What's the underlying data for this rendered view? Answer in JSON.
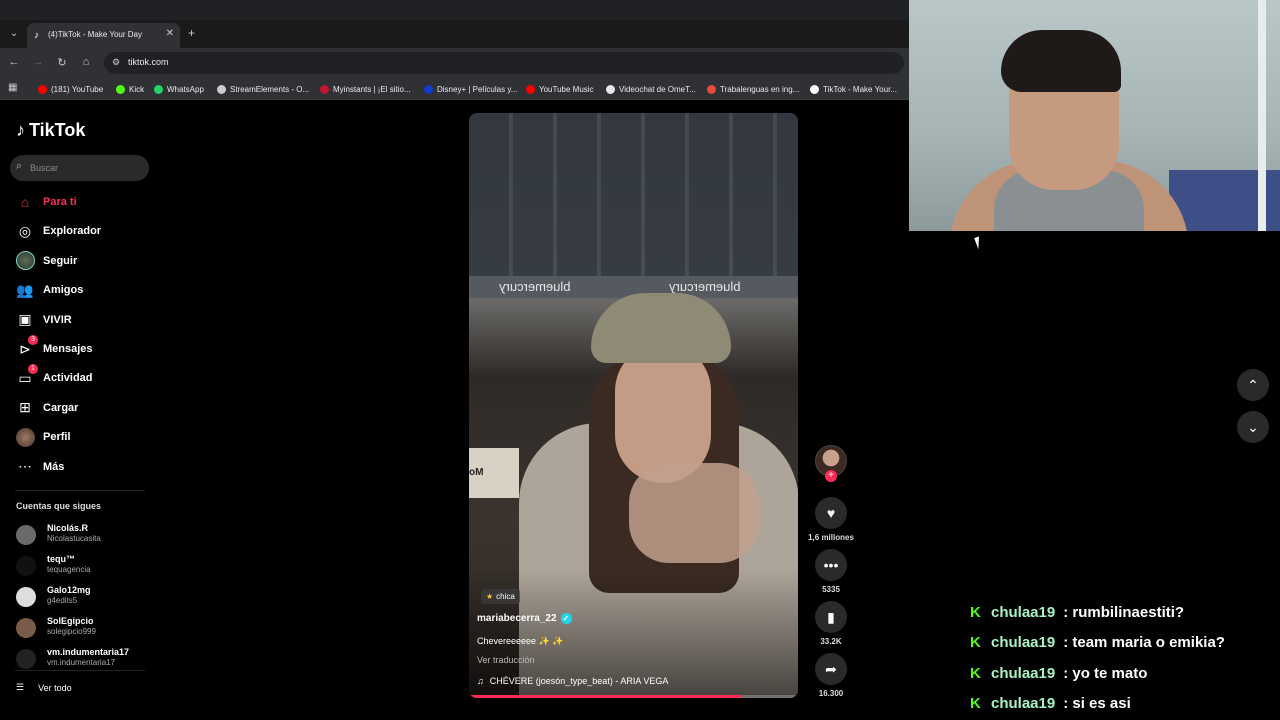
{
  "browser": {
    "tab_title": "(4)TikTok - Make Your Day",
    "url": "tiktok.com",
    "bookmarks": [
      {
        "label": "(181) YouTube",
        "icon": "youtube-icon",
        "color": "#ff0000"
      },
      {
        "label": "Kick",
        "icon": "kick-icon",
        "color": "#53fc18"
      },
      {
        "label": "WhatsApp",
        "icon": "whatsapp-icon",
        "color": "#25d366"
      },
      {
        "label": "StreamElements - O...",
        "icon": "streamelements-icon",
        "color": "#cccccc"
      },
      {
        "label": "Myinstants | ¡El sitio...",
        "icon": "myinstants-icon",
        "color": "#c0162c"
      },
      {
        "label": "Disney+ | Películas y...",
        "icon": "disney-icon",
        "color": "#113ccf"
      },
      {
        "label": "YouTube Music",
        "icon": "youtube-music-icon",
        "color": "#ff0000"
      },
      {
        "label": "Videochat de OmeT...",
        "icon": "ometv-icon",
        "color": "#e8e8e8"
      },
      {
        "label": "Trabalenguas en ing...",
        "icon": "trabalenguas-icon",
        "color": "#e94b3c"
      },
      {
        "label": "TikTok - Make Your...",
        "icon": "tiktok-icon",
        "color": "#ffffff"
      }
    ]
  },
  "tiktok": {
    "logo": "TikTok",
    "search_placeholder": "Buscar",
    "nav": [
      {
        "label": "Para ti",
        "icon": "home-icon",
        "active": true
      },
      {
        "label": "Explorador",
        "icon": "compass-icon"
      },
      {
        "label": "Seguir",
        "icon": "following-avatar-icon"
      },
      {
        "label": "Amigos",
        "icon": "friends-icon"
      },
      {
        "label": "VIVIR",
        "icon": "live-icon"
      },
      {
        "label": "Mensajes",
        "icon": "messages-icon",
        "badge": "3"
      },
      {
        "label": "Actividad",
        "icon": "activity-icon",
        "badge": "1"
      },
      {
        "label": "Cargar",
        "icon": "upload-icon"
      },
      {
        "label": "Perfil",
        "icon": "profile-avatar-icon"
      },
      {
        "label": "Más",
        "icon": "more-icon"
      }
    ],
    "following_title": "Cuentas que sigues",
    "following": [
      {
        "name": "Nicolás.R",
        "handle": "Nicolastucasita",
        "color": "#6a6a6a"
      },
      {
        "name": "tequ™",
        "handle": "tequagencia",
        "color": "#111111"
      },
      {
        "name": "Galo12mg",
        "handle": "g4edits5",
        "color": "#dddddd"
      },
      {
        "name": "SolEgipcio",
        "handle": "solegipcio999",
        "color": "#7a5a48"
      },
      {
        "name": "vm.indumentaria17",
        "handle": "vm.indumentaria17",
        "color": "#222222"
      }
    ],
    "see_all": "Ver todo",
    "video": {
      "tag": "chica",
      "author": "mariabecerra_22",
      "caption": "Chevereeeeee ✨ ✨",
      "translate": "Ver traducción",
      "music": "CHÉVERE (joesón_type_beat) - ARIA VEGA",
      "progress": 0.83,
      "store_text_left": "bluemercury",
      "store_text_right": "bluemercury",
      "sign_text": "Mo"
    },
    "actions": {
      "likes": "1,6 millones",
      "comments": "5335",
      "saves": "33.2K",
      "shares": "16.300"
    }
  },
  "chat": [
    {
      "user": "chulaa19",
      "message": ": rumbilinaestiti?"
    },
    {
      "user": "chulaa19",
      "message": ": team maria o emikia?"
    },
    {
      "user": "chulaa19",
      "message": ": yo te mato"
    },
    {
      "user": "chulaa19",
      "message": ": si es asi"
    }
  ],
  "colors": {
    "accent": "#fe2c55",
    "kick_green": "#53fc18",
    "chat_user": "#a9f2c4"
  }
}
